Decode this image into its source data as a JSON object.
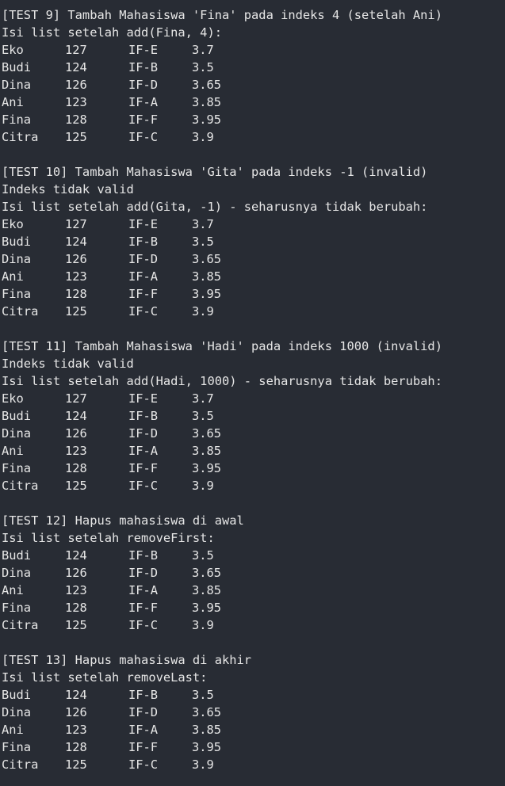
{
  "sections": [
    {
      "header": "[TEST 9] Tambah Mahasiswa 'Fina' pada indeks 4 (setelah Ani)",
      "pre": [],
      "caption": "Isi list setelah add(Fina, 4):",
      "rows": [
        [
          "Eko",
          "127",
          "IF-E",
          "3.7"
        ],
        [
          "Budi",
          "124",
          "IF-B",
          "3.5"
        ],
        [
          "Dina",
          "126",
          "IF-D",
          "3.65"
        ],
        [
          "Ani",
          "123",
          "IF-A",
          "3.85"
        ],
        [
          "Fina",
          "128",
          "IF-F",
          "3.95"
        ],
        [
          "Citra",
          "125",
          "IF-C",
          "3.9"
        ]
      ]
    },
    {
      "header": "[TEST 10] Tambah Mahasiswa 'Gita' pada indeks -1 (invalid)",
      "pre": [
        "Indeks tidak valid"
      ],
      "caption": "Isi list setelah add(Gita, -1) - seharusnya tidak berubah:",
      "rows": [
        [
          "Eko",
          "127",
          "IF-E",
          "3.7"
        ],
        [
          "Budi",
          "124",
          "IF-B",
          "3.5"
        ],
        [
          "Dina",
          "126",
          "IF-D",
          "3.65"
        ],
        [
          "Ani",
          "123",
          "IF-A",
          "3.85"
        ],
        [
          "Fina",
          "128",
          "IF-F",
          "3.95"
        ],
        [
          "Citra",
          "125",
          "IF-C",
          "3.9"
        ]
      ]
    },
    {
      "header": "[TEST 11] Tambah Mahasiswa 'Hadi' pada indeks 1000 (invalid)",
      "pre": [
        "Indeks tidak valid"
      ],
      "caption": "Isi list setelah add(Hadi, 1000) - seharusnya tidak berubah:",
      "rows": [
        [
          "Eko",
          "127",
          "IF-E",
          "3.7"
        ],
        [
          "Budi",
          "124",
          "IF-B",
          "3.5"
        ],
        [
          "Dina",
          "126",
          "IF-D",
          "3.65"
        ],
        [
          "Ani",
          "123",
          "IF-A",
          "3.85"
        ],
        [
          "Fina",
          "128",
          "IF-F",
          "3.95"
        ],
        [
          "Citra",
          "125",
          "IF-C",
          "3.9"
        ]
      ]
    },
    {
      "header": "[TEST 12] Hapus mahasiswa di awal",
      "pre": [],
      "caption": "Isi list setelah removeFirst:",
      "rows": [
        [
          "Budi",
          "124",
          "IF-B",
          "3.5"
        ],
        [
          "Dina",
          "126",
          "IF-D",
          "3.65"
        ],
        [
          "Ani",
          "123",
          "IF-A",
          "3.85"
        ],
        [
          "Fina",
          "128",
          "IF-F",
          "3.95"
        ],
        [
          "Citra",
          "125",
          "IF-C",
          "3.9"
        ]
      ]
    },
    {
      "header": "[TEST 13] Hapus mahasiswa di akhir",
      "pre": [],
      "caption": "Isi list setelah removeLast:",
      "rows": [
        [
          "Budi",
          "124",
          "IF-B",
          "3.5"
        ],
        [
          "Dina",
          "126",
          "IF-D",
          "3.65"
        ],
        [
          "Ani",
          "123",
          "IF-A",
          "3.85"
        ],
        [
          "Fina",
          "128",
          "IF-F",
          "3.95"
        ],
        [
          "Citra",
          "125",
          "IF-C",
          "3.9"
        ]
      ]
    }
  ]
}
